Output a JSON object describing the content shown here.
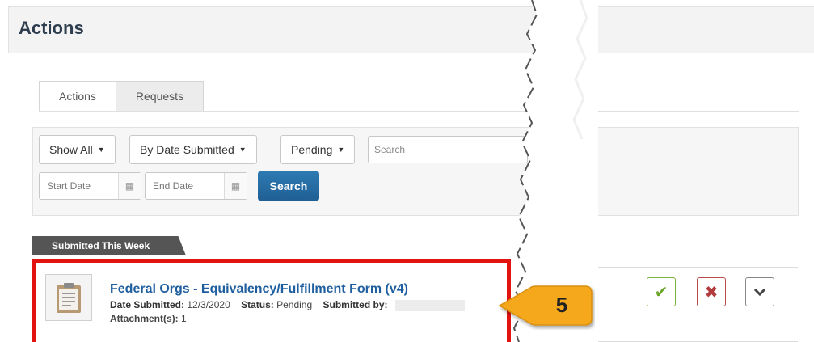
{
  "page": {
    "title": "Actions"
  },
  "tabs": [
    {
      "label": "Actions"
    },
    {
      "label": "Requests"
    }
  ],
  "filters": {
    "show_all": "Show All",
    "sort": "By Date Submitted",
    "status": "Pending",
    "search_placeholder": "Search",
    "start_date_placeholder": "Start Date",
    "end_date_placeholder": "End Date",
    "search_button": "Search"
  },
  "section": {
    "label": "Submitted This Week"
  },
  "item": {
    "title": "Federal Orgs - Equivalency/Fulfillment Form (v4)",
    "date_label": "Date Submitted:",
    "date_value": "12/3/2020",
    "status_label": "Status:",
    "status_value": "Pending",
    "submitted_by_label": "Submitted by:",
    "attachments_label": "Attachment(s):",
    "attachments_value": "1"
  },
  "callout": {
    "number": "5"
  },
  "colors": {
    "highlight": "#e3130f",
    "callout": "#f5a81c",
    "approve": "#6ba428",
    "reject": "#b23c3c",
    "link": "#1f5f9f",
    "primary_button": "#1f5f94"
  }
}
